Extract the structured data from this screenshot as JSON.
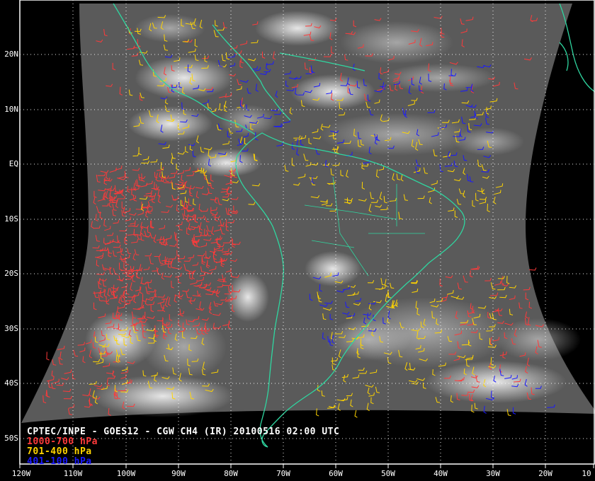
{
  "caption": {
    "title": "CPTEC/INPE - GOES12 - CGW CH4 (IR) 20100516 02:00 UTC",
    "legend": [
      {
        "label": "1000-700 hPa",
        "color": "#ff3a3a"
      },
      {
        "label": "701-400 hPa",
        "color": "#ffd400"
      },
      {
        "label": "401-100 hPa",
        "color": "#1a1aff"
      }
    ]
  },
  "lat_labels": [
    "20N",
    "10N",
    "EQ",
    "10S",
    "20S",
    "30S",
    "40S",
    "50S"
  ],
  "lon_labels": [
    "120W",
    "110W",
    "100W",
    "90W",
    "80W",
    "70W",
    "60W",
    "50W",
    "40W",
    "30W",
    "20W",
    "10"
  ],
  "colors": {
    "background": "#000000",
    "coastline": "#2fd6a0",
    "grid": "#ffffff",
    "wind_low": "#ff3a3a",
    "wind_mid": "#ffd400",
    "wind_high": "#1a1aff"
  }
}
